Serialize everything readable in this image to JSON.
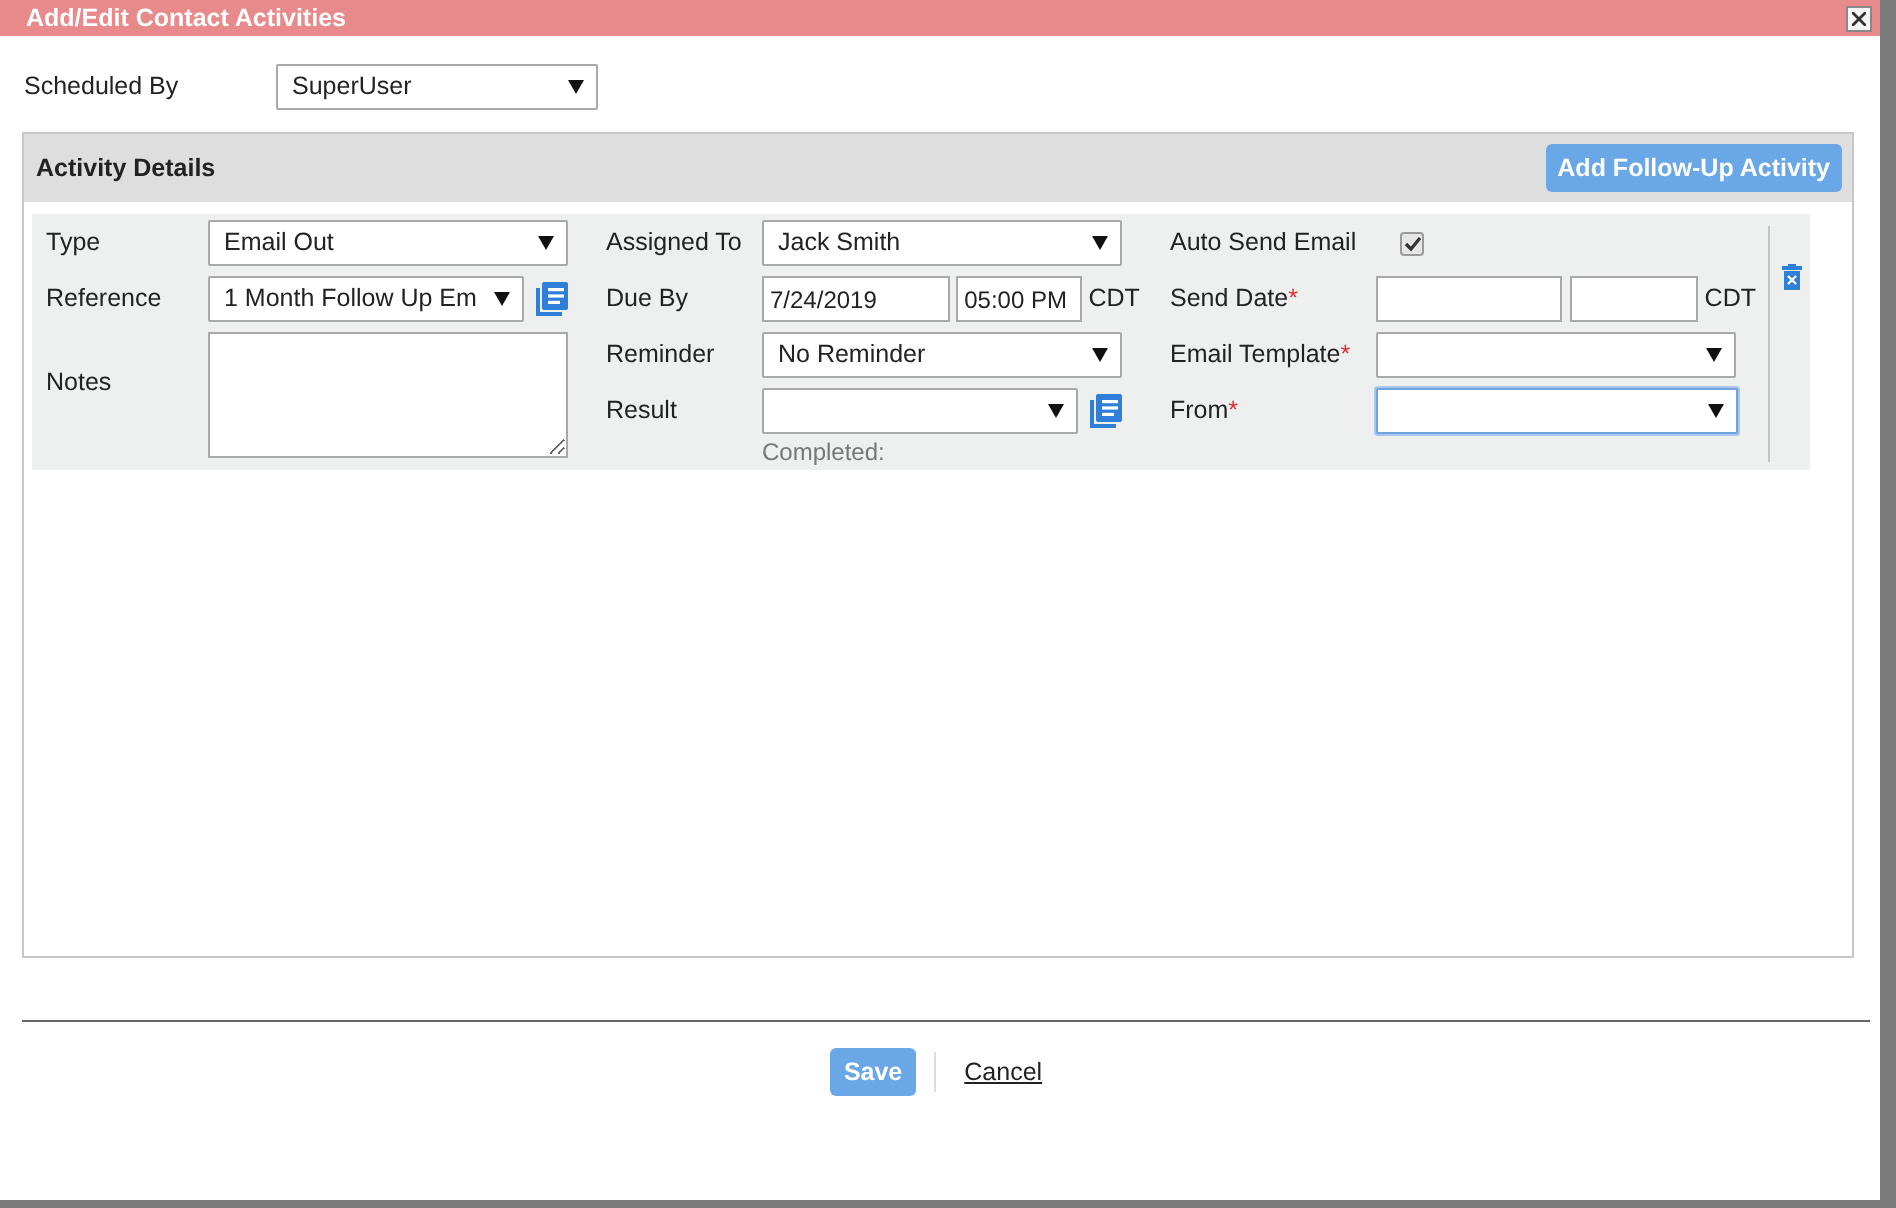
{
  "dialog": {
    "title": "Add/Edit Contact Activities"
  },
  "scheduled_by": {
    "label": "Scheduled By",
    "value": "SuperUser"
  },
  "section": {
    "title": "Activity Details",
    "add_button": "Add Follow-Up Activity"
  },
  "activity": {
    "type": {
      "label": "Type",
      "value": "Email Out"
    },
    "reference": {
      "label": "Reference",
      "value": "1 Month Follow Up Em"
    },
    "notes": {
      "label": "Notes"
    },
    "assigned_to": {
      "label": "Assigned To",
      "value": "Jack Smith"
    },
    "due_by": {
      "label": "Due By",
      "date": "7/24/2019",
      "time": "05:00 PM",
      "zone": "CDT"
    },
    "reminder": {
      "label": "Reminder",
      "value": "No Reminder"
    },
    "result": {
      "label": "Result",
      "note": "Completed:"
    },
    "auto_send_email": {
      "label": "Auto Send Email",
      "checked": true
    },
    "send_date": {
      "label": "Send Date",
      "required_mark": "*",
      "zone": "CDT"
    },
    "email_template": {
      "label": "Email Template",
      "required_mark": "*"
    },
    "from": {
      "label": "From",
      "required_mark": "*",
      "focused": true
    }
  },
  "footer": {
    "save": "Save",
    "cancel": "Cancel"
  }
}
